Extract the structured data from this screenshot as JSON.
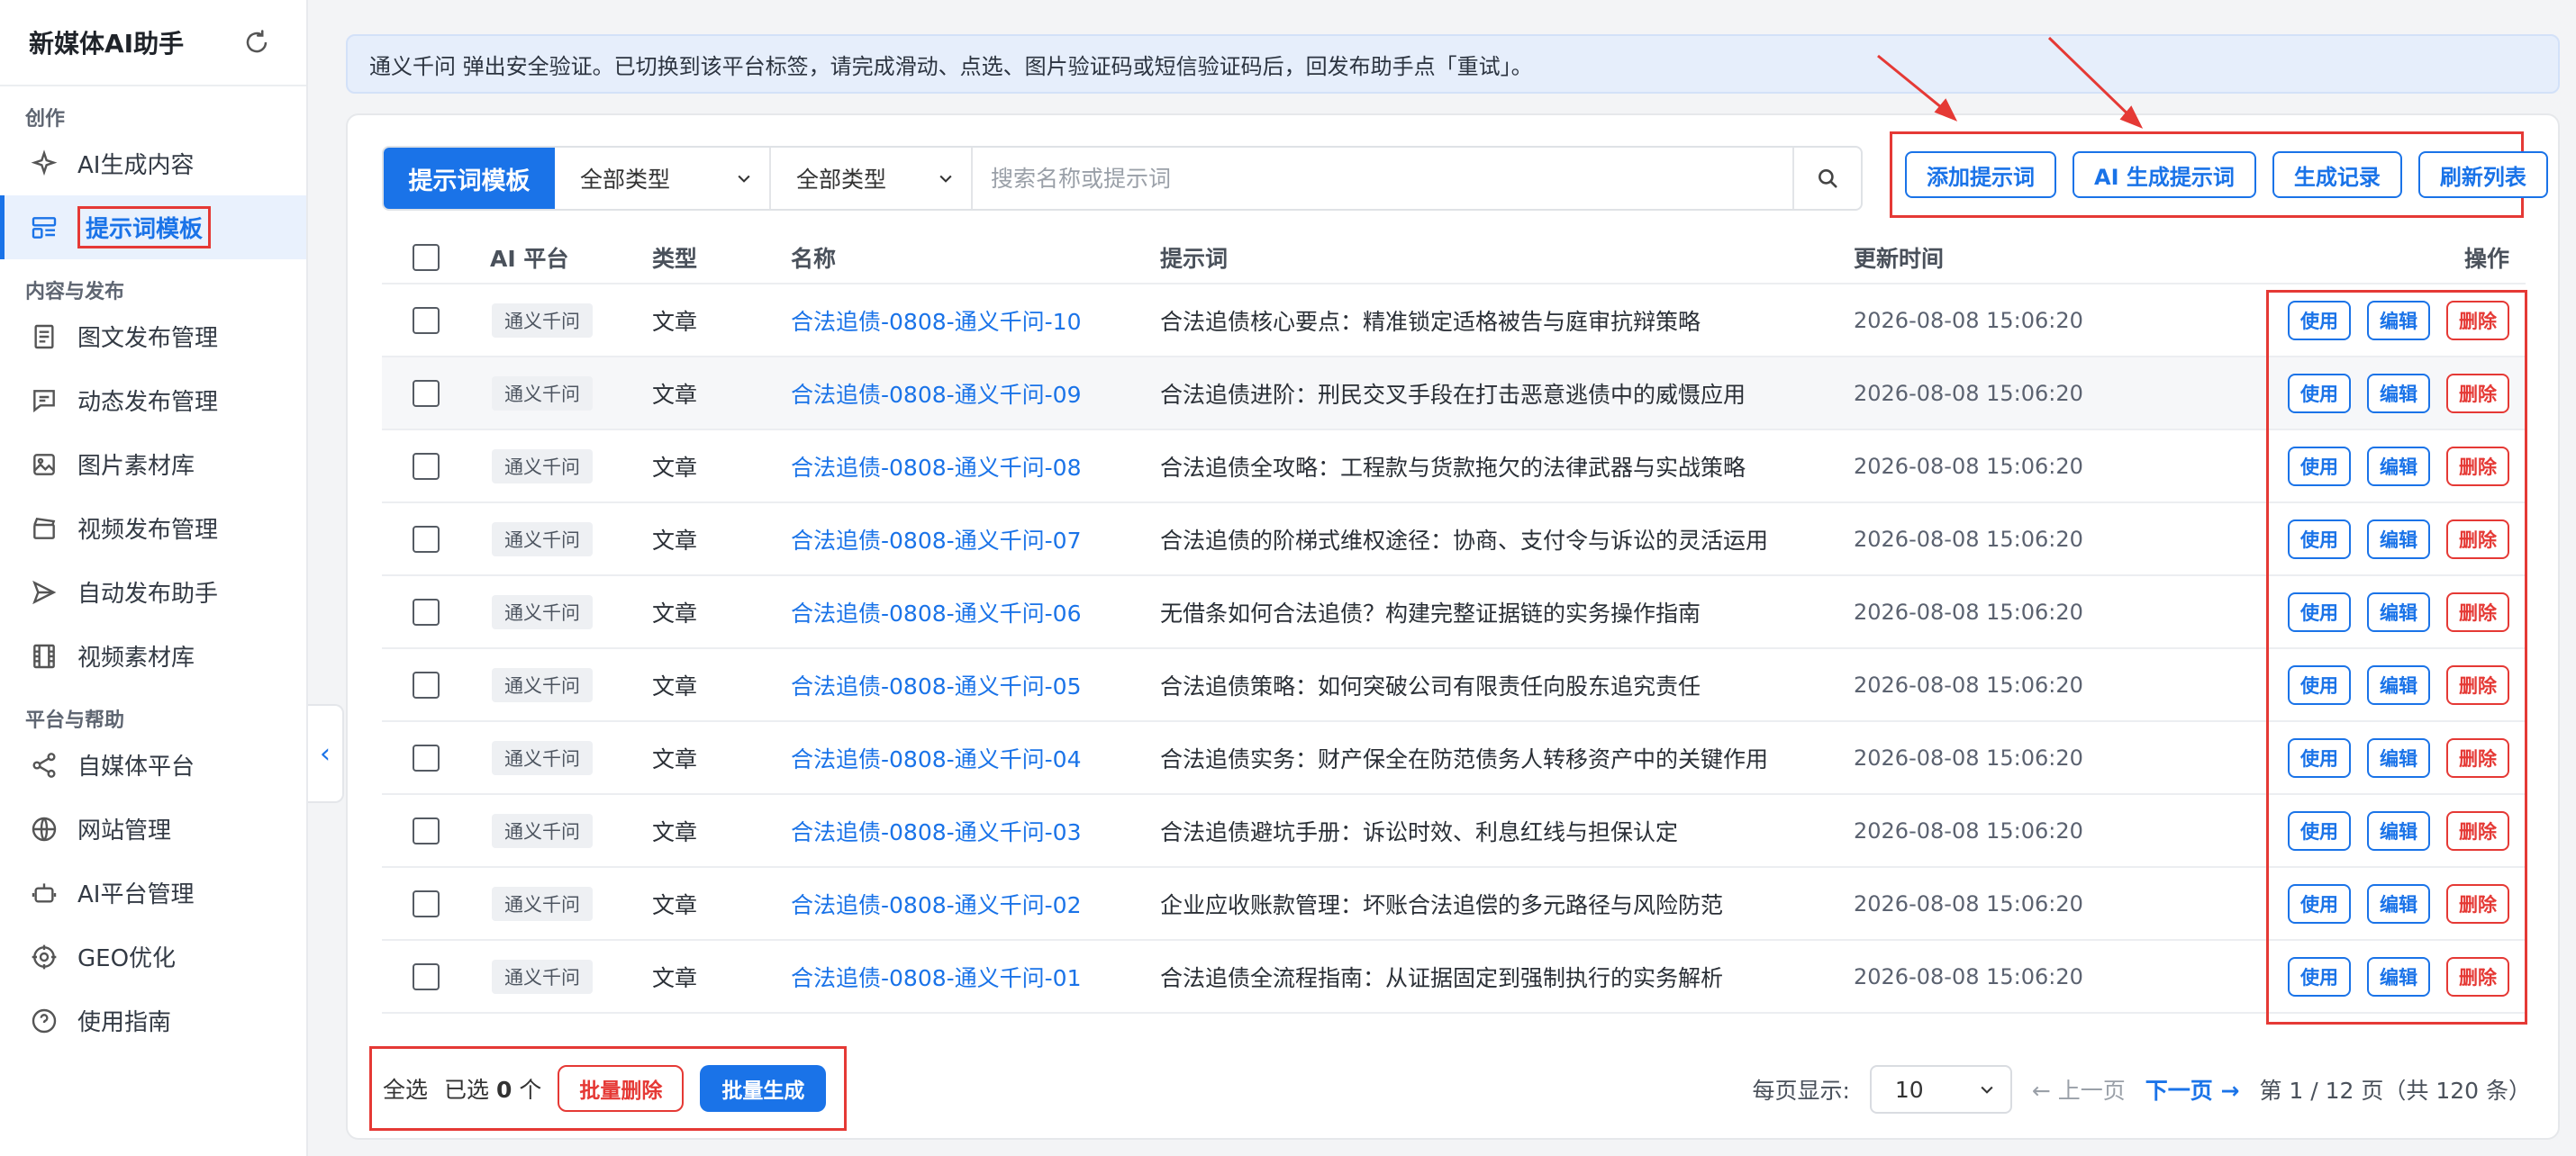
{
  "app": {
    "title": "新媒体AI助手"
  },
  "sidebar": {
    "sections": [
      {
        "title": "创作",
        "items": [
          {
            "label": "AI生成内容",
            "icon": "sparkle-icon"
          },
          {
            "label": "提示词模板",
            "icon": "template-icon",
            "active": true
          }
        ]
      },
      {
        "title": "内容与发布",
        "items": [
          {
            "label": "图文发布管理",
            "icon": "document-icon"
          },
          {
            "label": "动态发布管理",
            "icon": "chat-icon"
          },
          {
            "label": "图片素材库",
            "icon": "image-icon"
          },
          {
            "label": "视频发布管理",
            "icon": "clapperboard-icon"
          },
          {
            "label": "自动发布助手",
            "icon": "send-icon"
          },
          {
            "label": "视频素材库",
            "icon": "film-icon"
          }
        ]
      },
      {
        "title": "平台与帮助",
        "items": [
          {
            "label": "自媒体平台",
            "icon": "share-icon"
          },
          {
            "label": "网站管理",
            "icon": "globe-icon"
          },
          {
            "label": "AI平台管理",
            "icon": "robot-icon"
          },
          {
            "label": "GEO优化",
            "icon": "target-icon"
          },
          {
            "label": "使用指南",
            "icon": "help-icon"
          }
        ]
      }
    ]
  },
  "notice": "通义千问 弹出安全验证。已切换到该平台标签，请完成滑动、点选、图片验证码或短信验证码后，回发布助手点「重试」。",
  "toolbar": {
    "template_label": "提示词模板",
    "filter1": "全部类型",
    "filter2": "全部类型",
    "search_placeholder": "搜索名称或提示词"
  },
  "actions": {
    "add": "添加提示词",
    "ai_generate": "AI 生成提示词",
    "history": "生成记录",
    "refresh": "刷新列表"
  },
  "table": {
    "headers": {
      "platform": "AI 平台",
      "type": "类型",
      "name": "名称",
      "prompt": "提示词",
      "updated": "更新时间",
      "ops": "操作"
    },
    "op_labels": {
      "use": "使用",
      "edit": "编辑",
      "delete": "删除"
    },
    "rows": [
      {
        "platform": "通义千问",
        "type": "文章",
        "name": "合法追债-0808-通义千问-10",
        "prompt": "合法追债核心要点：精准锁定适格被告与庭审抗辩策略",
        "updated": "2026-08-08 15:06:20"
      },
      {
        "platform": "通义千问",
        "type": "文章",
        "name": "合法追债-0808-通义千问-09",
        "prompt": "合法追债进阶：刑民交叉手段在打击恶意逃债中的威慑应用",
        "updated": "2026-08-08 15:06:20"
      },
      {
        "platform": "通义千问",
        "type": "文章",
        "name": "合法追债-0808-通义千问-08",
        "prompt": "合法追债全攻略：工程款与货款拖欠的法律武器与实战策略",
        "updated": "2026-08-08 15:06:20"
      },
      {
        "platform": "通义千问",
        "type": "文章",
        "name": "合法追债-0808-通义千问-07",
        "prompt": "合法追债的阶梯式维权途径：协商、支付令与诉讼的灵活运用",
        "updated": "2026-08-08 15:06:20"
      },
      {
        "platform": "通义千问",
        "type": "文章",
        "name": "合法追债-0808-通义千问-06",
        "prompt": "无借条如何合法追债？构建完整证据链的实务操作指南",
        "updated": "2026-08-08 15:06:20"
      },
      {
        "platform": "通义千问",
        "type": "文章",
        "name": "合法追债-0808-通义千问-05",
        "prompt": "合法追债策略：如何突破公司有限责任向股东追究责任",
        "updated": "2026-08-08 15:06:20"
      },
      {
        "platform": "通义千问",
        "type": "文章",
        "name": "合法追债-0808-通义千问-04",
        "prompt": "合法追债实务：财产保全在防范债务人转移资产中的关键作用",
        "updated": "2026-08-08 15:06:20"
      },
      {
        "platform": "通义千问",
        "type": "文章",
        "name": "合法追债-0808-通义千问-03",
        "prompt": "合法追债避坑手册：诉讼时效、利息红线与担保认定",
        "updated": "2026-08-08 15:06:20"
      },
      {
        "platform": "通义千问",
        "type": "文章",
        "name": "合法追债-0808-通义千问-02",
        "prompt": "企业应收账款管理：坏账合法追偿的多元路径与风险防范",
        "updated": "2026-08-08 15:06:20"
      },
      {
        "platform": "通义千问",
        "type": "文章",
        "name": "合法追债-0808-通义千问-01",
        "prompt": "合法追债全流程指南：从证据固定到强制执行的实务解析",
        "updated": "2026-08-08 15:06:20"
      }
    ]
  },
  "bulk": {
    "select_all": "全选",
    "selected_prefix": "已选",
    "selected_count": "0",
    "selected_suffix": "个",
    "batch_delete": "批量删除",
    "batch_generate": "批量生成"
  },
  "pager": {
    "per_page_label": "每页显示:",
    "per_page": "10",
    "prev": "← 上一页",
    "next": "下一页 →",
    "info": "第 1 / 12 页（共 120 条）"
  },
  "colors": {
    "accent": "#1a73e8",
    "danger": "#e53935",
    "annotation": "#e53935"
  }
}
